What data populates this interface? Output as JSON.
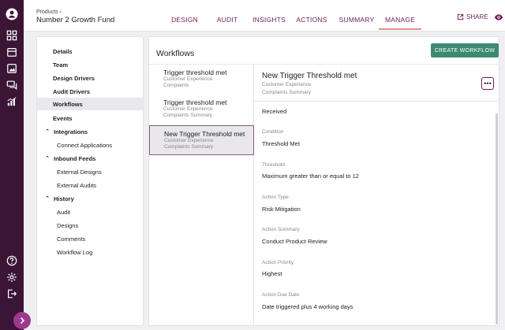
{
  "breadcrumb": {
    "parent": "Products",
    "separator": "›"
  },
  "fund": {
    "name": "Number 2 Growth Fund"
  },
  "tabs": [
    {
      "label": "DESIGN"
    },
    {
      "label": "AUDIT"
    },
    {
      "label": "INSIGHTS"
    },
    {
      "label": "ACTIONS"
    },
    {
      "label": "SUMMARY"
    },
    {
      "label": "MANAGE",
      "active": true
    }
  ],
  "header_actions": {
    "share_label": "SHARE"
  },
  "rail_icons": [
    "user-circle-icon",
    "dashboard-icon",
    "calendar-icon",
    "image-icon",
    "chat-icon",
    "chart-icon",
    "help-icon",
    "settings-icon",
    "logout-icon"
  ],
  "sidebar": {
    "items": [
      {
        "label": "Details",
        "bold": true
      },
      {
        "label": "Team",
        "bold": true
      },
      {
        "label": "Design Drivers",
        "bold": true
      },
      {
        "label": "Audit Drivers",
        "bold": true
      },
      {
        "label": "Workflows",
        "bold": true,
        "active": true
      },
      {
        "label": "Events",
        "bold": true
      },
      {
        "label": "Integrations",
        "bold": true,
        "expandable": true
      },
      {
        "label": "Connect Applications",
        "child": true
      },
      {
        "label": "Inbound Feeds",
        "bold": true,
        "expandable": true
      },
      {
        "label": "External Designs",
        "child": true
      },
      {
        "label": "External Audits",
        "child": true
      },
      {
        "label": "History",
        "bold": true,
        "expandable": true
      },
      {
        "label": "Audit",
        "child": true
      },
      {
        "label": "Designs",
        "child": true
      },
      {
        "label": "Comments",
        "child": true
      },
      {
        "label": "Workflow Log",
        "child": true
      }
    ]
  },
  "workflows": {
    "title": "Workflows",
    "create_label": "CREATE WORKFLOW",
    "list": [
      {
        "title": "Trigger threshold met",
        "line1": "Customer Experience",
        "line2": "Complaints"
      },
      {
        "title": "Trigger threshold met",
        "line1": "Customer Experience",
        "line2": "Complaints Summary"
      },
      {
        "title": "New Trigger Threshold met",
        "line1": "Customer Experience",
        "line2": "Complaints Summary",
        "selected": true
      }
    ]
  },
  "detail": {
    "title": "New Trigger Threshold met",
    "line1": "Customer Experience",
    "line2": "Complaints Summary",
    "more_label": "•••",
    "top_value": "Received",
    "fields": [
      {
        "label": "Condition",
        "value": "Threshold Met"
      },
      {
        "label": "Threshold",
        "value": "Maximum greater than or equal to 12"
      },
      {
        "label": "Action Type",
        "value": "Risk Mitigation"
      },
      {
        "label": "Action Summary",
        "value": "Conduct Product Review"
      },
      {
        "label": "Action Priority",
        "value": "Highest"
      },
      {
        "label": "Action Due Date",
        "value": "Date triggered plus 4 working days"
      }
    ]
  }
}
